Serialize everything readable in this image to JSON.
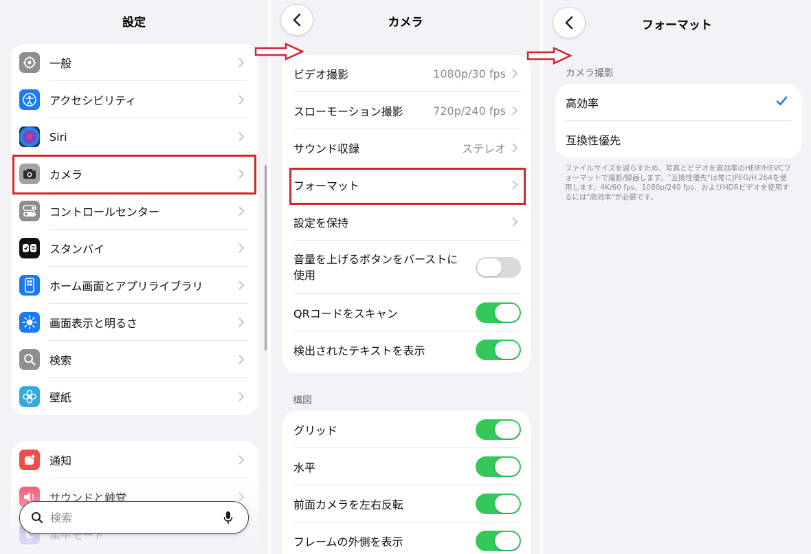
{
  "settings": {
    "title": "設定",
    "items": [
      {
        "label": "一般",
        "icon": "gear-icon",
        "color": "#8e8e93"
      },
      {
        "label": "アクセシビリティ",
        "icon": "accessibility-icon",
        "color": "#1a7cf5"
      },
      {
        "label": "Siri",
        "icon": "siri-icon",
        "color": "#2b2b3a"
      },
      {
        "label": "カメラ",
        "icon": "camera-icon",
        "color": "#8e8e93"
      },
      {
        "label": "コントロールセンター",
        "icon": "control-center-icon",
        "color": "#8e8e93"
      },
      {
        "label": "スタンバイ",
        "icon": "standby-icon",
        "color": "#111111"
      },
      {
        "label": "ホーム画面とアプリライブラリ",
        "icon": "home-screen-icon",
        "color": "#1a7cf5"
      },
      {
        "label": "画面表示と明るさ",
        "icon": "brightness-icon",
        "color": "#1a7cf5"
      },
      {
        "label": "検索",
        "icon": "search-icon",
        "color": "#8e8e93"
      },
      {
        "label": "壁紙",
        "icon": "wallpaper-icon",
        "color": "#35aadc"
      }
    ],
    "items2": [
      {
        "label": "通知",
        "icon": "notification-icon",
        "color": "#f24d4d"
      },
      {
        "label": "サウンドと触覚",
        "icon": "sound-icon",
        "color": "#f24d6d"
      },
      {
        "label": "集中モード",
        "icon": "focus-icon",
        "color": "#5e5ce6"
      }
    ],
    "search_placeholder": "検索"
  },
  "camera": {
    "title": "カメラ",
    "rows": [
      {
        "label": "ビデオ撮影",
        "value": "1080p/30 fps"
      },
      {
        "label": "スローモーション撮影",
        "value": "720p/240 fps"
      },
      {
        "label": "サウンド収録",
        "value": "ステレオ"
      },
      {
        "label": "フォーマット",
        "value": ""
      },
      {
        "label": "設定を保持",
        "value": ""
      }
    ],
    "toggles": [
      {
        "label": "音量を上げるボタンをバーストに使用",
        "on": false
      },
      {
        "label": "QRコードをスキャン",
        "on": true
      },
      {
        "label": "検出されたテキストを表示",
        "on": true
      }
    ],
    "composition_header": "構図",
    "composition_toggles": [
      {
        "label": "グリッド",
        "on": true
      },
      {
        "label": "水平",
        "on": true
      },
      {
        "label": "前面カメラを左右反転",
        "on": true
      },
      {
        "label": "フレームの外側を表示",
        "on": true
      }
    ]
  },
  "format": {
    "title": "フォーマット",
    "section_header": "カメラ撮影",
    "options": [
      {
        "label": "高効率",
        "selected": true
      },
      {
        "label": "互換性優先",
        "selected": false
      }
    ],
    "footnote": "ファイルサイズを減らすため、写真とビデオを高効率のHEIF/HEVCフォーマットで撮影/録画します。\"互換性優先\"は常にJPEG/H.264を使用します。4K/60 fps、1080p/240 fps、およびHDRビデオを使用するには\"高効率\"が必要です。"
  },
  "colors": {
    "accent": "#007aff",
    "toggle_on": "#34c759",
    "highlight": "#d3262a"
  }
}
